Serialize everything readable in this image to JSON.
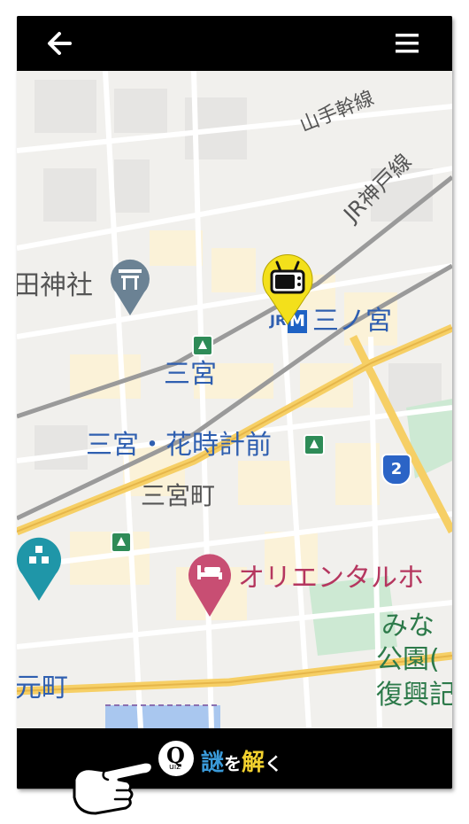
{
  "topbar": {
    "back_icon": "arrow-left-icon",
    "menu_icon": "hamburger-menu-icon"
  },
  "map": {
    "labels": {
      "yamanote_line": "山手幹線",
      "jr_kobe_line": "JR神戸線",
      "shrine": "田神社",
      "sannomiya_station": "三ノ宮",
      "jr_badge": "JR",
      "metro_badge": "M",
      "sannomiya_blue": "三宮",
      "hanadokei_mae": "三宮・花時計前",
      "sannomiya_cho": "三宮町",
      "oriental": "オリエンタルホ",
      "mina": "みな",
      "park": "公園(",
      "fukko": "復興記",
      "motomachi": "元町",
      "route_shield": "2"
    },
    "pins": {
      "tv_pin_icon": "tv-icon",
      "hotel_pin_icon": "bed-icon",
      "shrine_pin_icon": "torii-icon"
    },
    "colors": {
      "highway": "#f6cf65",
      "road": "#ffffff",
      "rail": "#9a9a9a",
      "park": "#cde9d3",
      "water": "#a9c7ef",
      "block": "#fbf2d8"
    }
  },
  "bottombar": {
    "quiz_logo": "Q",
    "quiz_logo_sub": "uiz",
    "quiz_text_1": "謎",
    "quiz_text_2": "を",
    "quiz_text_3": "解",
    "quiz_text_4": "く",
    "hand_icon": "pointing-hand-icon"
  }
}
